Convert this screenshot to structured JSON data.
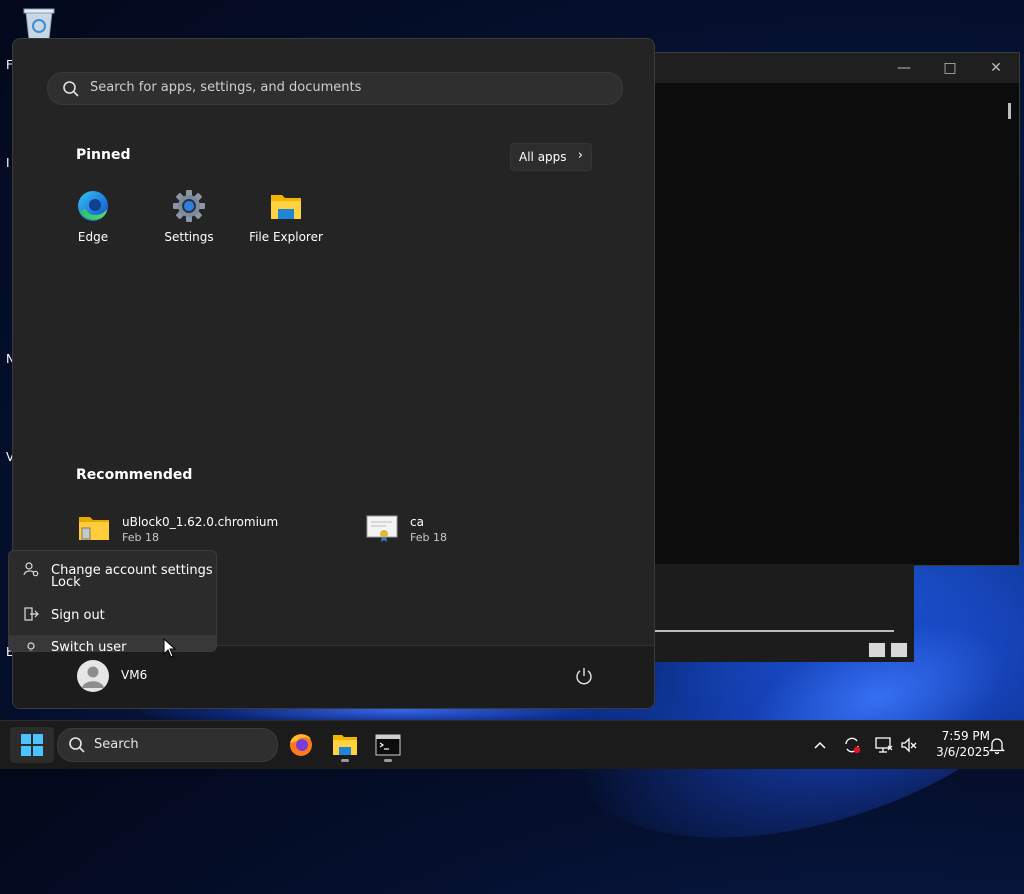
{
  "desktop": {
    "left_letters": [
      "F",
      "I",
      "N",
      "V",
      "E"
    ]
  },
  "terminal": {
    "minimize_glyph": "—",
    "maximize_glyph": "□",
    "close_glyph": "✕"
  },
  "start_menu": {
    "search_placeholder": "Search for apps, settings, and documents",
    "pinned_title": "Pinned",
    "all_apps_label": "All apps",
    "pinned": [
      {
        "label": "Edge",
        "icon": "edge-icon"
      },
      {
        "label": "Settings",
        "icon": "settings-gear-icon"
      },
      {
        "label": "File Explorer",
        "icon": "file-explorer-icon"
      }
    ],
    "recommended_title": "Recommended",
    "recommended": [
      {
        "name": "uBlock0_1.62.0.chromium",
        "date": "Feb 18",
        "icon": "zip-folder-icon"
      },
      {
        "name": "ca",
        "date": "Feb 18",
        "icon": "certificate-icon"
      }
    ],
    "user_name": "VM6"
  },
  "account_menu": {
    "items": [
      {
        "label": "Change account settings",
        "icon": "account-settings-icon"
      },
      {
        "label": "Lock",
        "icon": "lock-icon"
      },
      {
        "label": "Sign out",
        "icon": "sign-out-icon"
      },
      {
        "label": "Switch user",
        "icon": "switch-user-icon"
      }
    ]
  },
  "taskbar": {
    "search_placeholder": "Search",
    "apps": [
      "firefox-icon",
      "file-explorer-icon",
      "terminal-icon"
    ],
    "time": "7:59 PM",
    "date": "3/6/2025"
  },
  "colors": {
    "start_bg": "#242424",
    "taskbar_bg": "#1b1b1b",
    "accent": "#4cc2ff"
  }
}
